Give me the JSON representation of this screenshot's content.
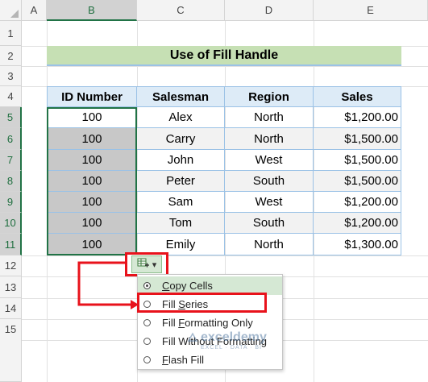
{
  "columns": [
    "A",
    "B",
    "C",
    "D",
    "E"
  ],
  "rows": [
    "1",
    "2",
    "3",
    "4",
    "5",
    "6",
    "7",
    "8",
    "9",
    "10",
    "11",
    "12",
    "13",
    "14",
    "15"
  ],
  "title": "Use of Fill Handle",
  "table": {
    "headers": [
      "ID Number",
      "Salesman",
      "Region",
      "Sales"
    ],
    "rows": [
      [
        "100",
        "Alex",
        "North",
        "$1,200.00"
      ],
      [
        "100",
        "Carry",
        "North",
        "$1,500.00"
      ],
      [
        "100",
        "John",
        "West",
        "$1,500.00"
      ],
      [
        "100",
        "Peter",
        "South",
        "$1,500.00"
      ],
      [
        "100",
        "Sam",
        "West",
        "$1,200.00"
      ],
      [
        "100",
        "Tom",
        "South",
        "$1,200.00"
      ],
      [
        "100",
        "Emily",
        "North",
        "$1,300.00"
      ]
    ]
  },
  "autofill_menu": {
    "items": [
      {
        "pre": "",
        "ul": "C",
        "post": "opy Cells",
        "checked": true
      },
      {
        "pre": "Fill ",
        "ul": "S",
        "post": "eries",
        "checked": false
      },
      {
        "pre": "Fill ",
        "ul": "F",
        "post": "ormatting Only",
        "checked": false
      },
      {
        "pre": "Fill Without Formatting",
        "ul": "",
        "post": "",
        "checked": false
      },
      {
        "pre": "",
        "ul": "F",
        "post": "lash Fill",
        "checked": false
      }
    ]
  },
  "watermark": {
    "brand": "exceldemy",
    "tagline": "EXCEL · DATA · BI"
  },
  "colors": {
    "accent": "#217346",
    "highlight": "#e8121b",
    "header_fill": "#ddebf7",
    "title_fill": "#c6e0b4"
  }
}
